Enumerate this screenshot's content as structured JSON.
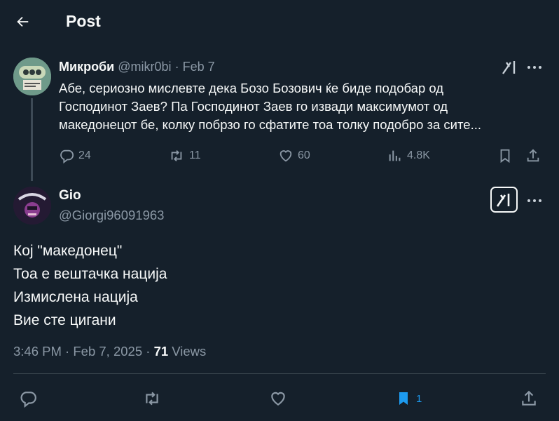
{
  "header": {
    "title": "Post"
  },
  "parent_tweet": {
    "name": "Микроби",
    "handle": "@mikr0bi",
    "dot": "·",
    "date": "Feb 7",
    "lines": [
      "Абе, сериозно мислевте дека Бозо Бозович ќе биде подобар од",
      "Господинот Заев? Па Господинот Заев го извади максимумот од",
      "македонецот бе, колку побрзо го сфатите тоа толку подобро за сите..."
    ],
    "stats": {
      "replies": "24",
      "reposts": "11",
      "likes": "60",
      "views": "4.8K"
    }
  },
  "main_tweet": {
    "name": "Gio",
    "handle": "@Giorgi96091963",
    "lines": [
      "Кој \"македонец\"",
      "Тоа е вештачка нација",
      "Измислена нација",
      "Вие сте цигани"
    ],
    "time": "3:46 PM",
    "dot": "·",
    "date": "Feb 7, 2025",
    "dot2": "·",
    "views_count": "71",
    "views_label": "Views",
    "bookmark_count": "1"
  },
  "colors": {
    "background": "#15202b",
    "text": "#f7f9f9",
    "muted": "#8b98a5",
    "accent": "#1d9bf0",
    "divider": "#38444d"
  },
  "icons": [
    "back-arrow-icon",
    "grok-icon",
    "more-icon",
    "reply-icon",
    "repost-icon",
    "like-icon",
    "views-icon",
    "bookmark-icon",
    "share-icon"
  ]
}
